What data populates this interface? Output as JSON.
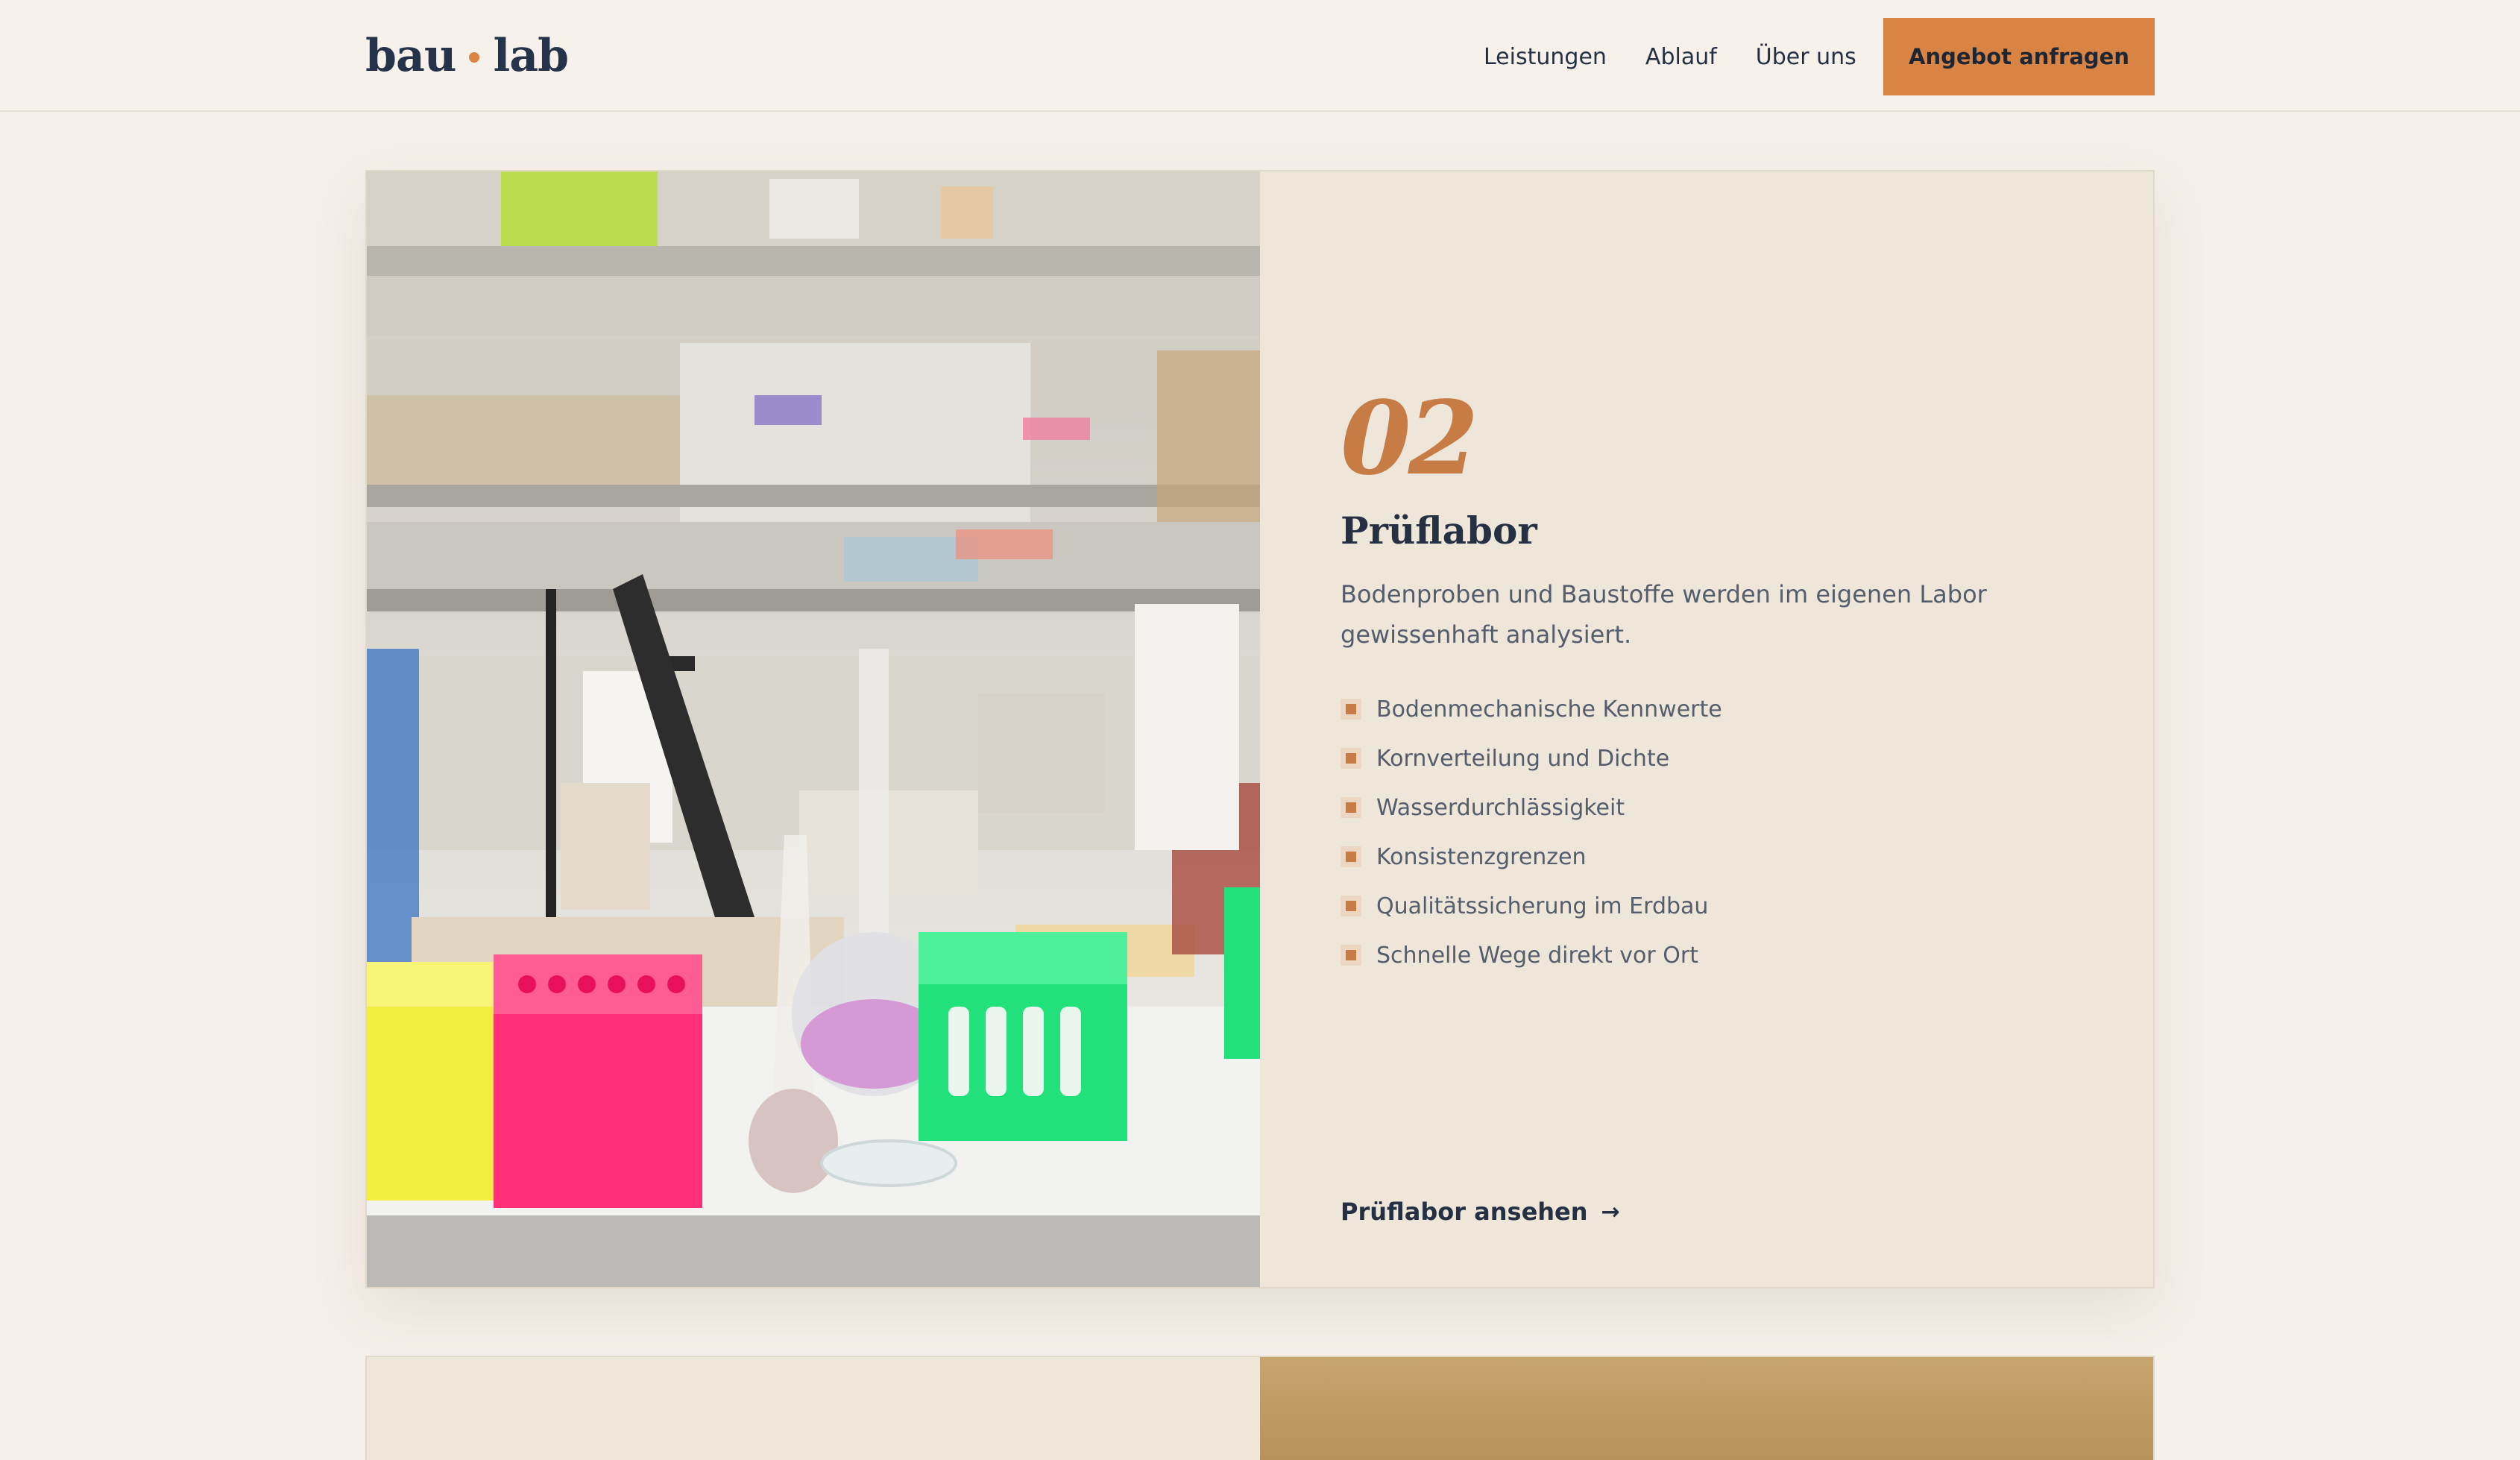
{
  "header": {
    "logo": {
      "left": "bau",
      "right": "lab"
    },
    "nav": [
      {
        "label": "Leistungen"
      },
      {
        "label": "Ablauf"
      },
      {
        "label": "Über uns"
      }
    ],
    "cta_label": "Angebot anfragen"
  },
  "feature": {
    "number": "02",
    "title": "Prüflabor",
    "description": "Bodenproben und Baustoffe werden im eigenen Labor gewissenhaft analysiert.",
    "items": [
      "Bodenmechanische Kennwerte",
      "Kornverteilung und Dichte",
      "Wasserdurchlässigkeit",
      "Konsistenzgrenzen",
      "Qualitätssicherung im Erdbau",
      "Schnelle Wege direkt vor Ort"
    ],
    "link_label": "Prüflabor ansehen",
    "link_arrow": "→"
  },
  "colors": {
    "accent": "#d98442",
    "heading": "#253043",
    "page_bg": "#f6f0ea",
    "card_bg": "#efe6da"
  }
}
